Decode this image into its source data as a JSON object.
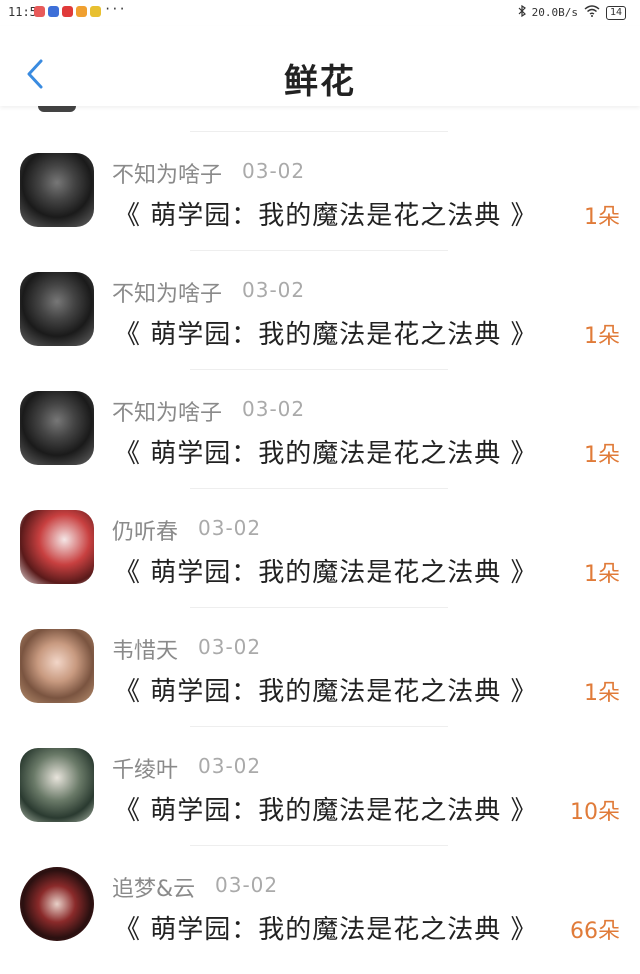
{
  "status_bar": {
    "time": "11:58",
    "more": "···",
    "network_speed": "20.0B/s",
    "battery": "14",
    "app_icon_colors": [
      "#e85a5a",
      "#3d6fd8",
      "#e03a3a",
      "#f0a030",
      "#e8c030"
    ]
  },
  "header": {
    "title": "鲜花",
    "back_icon": "chevron-left-icon",
    "accent_color": "#3a8be0"
  },
  "items": [
    {
      "user": "不知为啥子",
      "date": "03-02",
      "book": "《 萌学园：我的魔法是花之法典 》",
      "count": "1朵",
      "avatar": "grayscale-portrait"
    },
    {
      "user": "不知为啥子",
      "date": "03-02",
      "book": "《 萌学园：我的魔法是花之法典 》",
      "count": "1朵",
      "avatar": "grayscale-portrait"
    },
    {
      "user": "不知为啥子",
      "date": "03-02",
      "book": "《 萌学园：我的魔法是花之法典 》",
      "count": "1朵",
      "avatar": "grayscale-portrait"
    },
    {
      "user": "仍听春",
      "date": "03-02",
      "book": "《 萌学园：我的魔法是花之法典 》",
      "count": "1朵",
      "avatar": "anime-red"
    },
    {
      "user": "韦惜天",
      "date": "03-02",
      "book": "《 萌学园：我的魔法是花之法典 》",
      "count": "1朵",
      "avatar": "portrait-girl"
    },
    {
      "user": "千绫叶",
      "date": "03-02",
      "book": "《 萌学园：我的魔法是花之法典 》",
      "count": "10朵",
      "avatar": "anime-green"
    },
    {
      "user": "追梦&云",
      "date": "03-02",
      "book": "《 萌学园：我的魔法是花之法典 》",
      "count": "66朵",
      "avatar": "anime-dark-red"
    }
  ]
}
